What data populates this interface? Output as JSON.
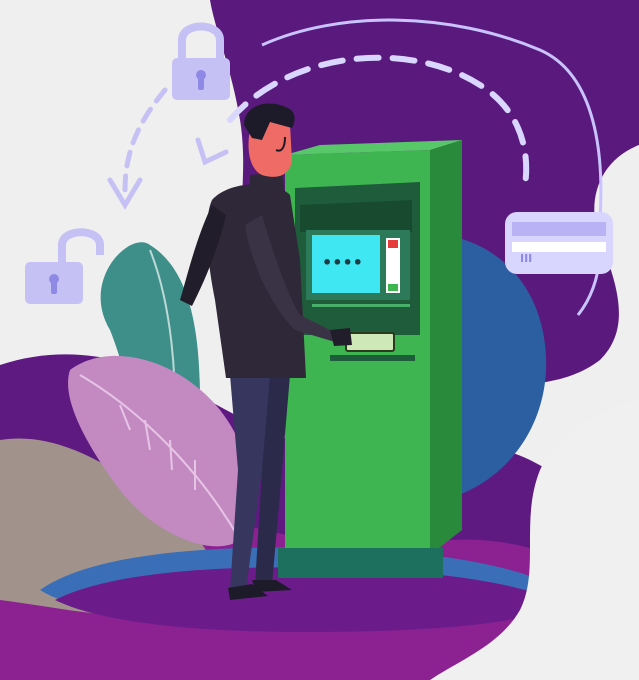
{
  "scene": {
    "description_hidden": "",
    "atm": {
      "screen_pin_mask": "••••",
      "card_stripe_marks": "III"
    }
  },
  "colors": {
    "background": "#efefef",
    "purple_dark": "#541a7a",
    "purple_mid": "#7b1f8f",
    "magenta": "#a12a95",
    "atm_green": "#3fb551",
    "atm_green_dark": "#2a8a3b",
    "atm_teal_base": "#1d6f5e",
    "screen_cyan": "#3ee7f2",
    "lock_lilac": "#c6c1f5",
    "man_coat": "#2e2838",
    "man_skin": "#ef6b66",
    "leaf_pink": "#c38ac2",
    "leaf_teal": "#3d8d8a",
    "blue_blob": "#2f61a6"
  },
  "icons": [
    "closed-padlock-icon",
    "open-padlock-icon",
    "credit-card-icon"
  ]
}
